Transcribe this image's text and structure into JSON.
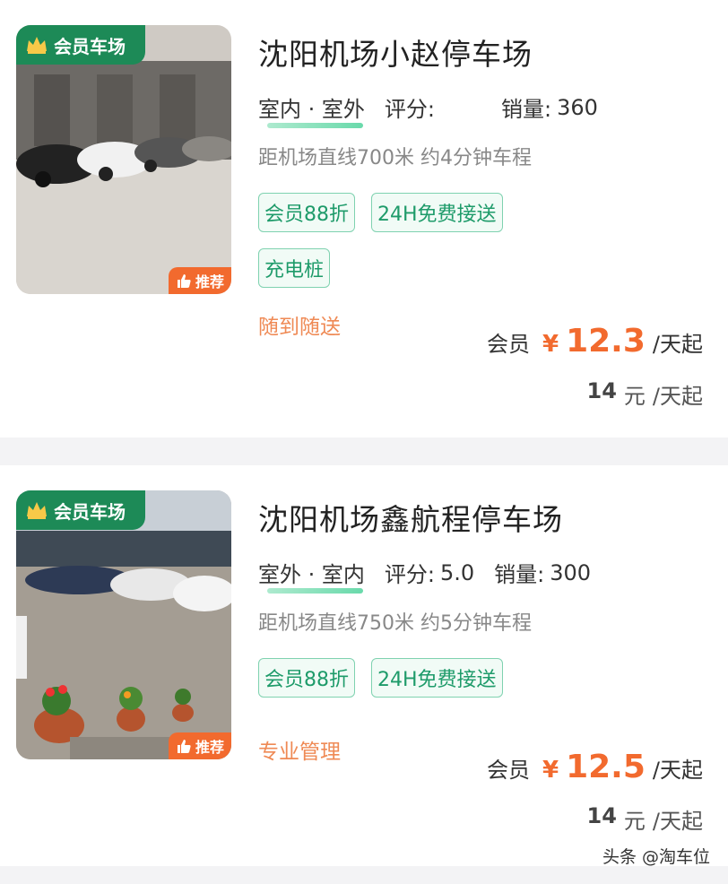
{
  "listings": [
    {
      "badge": "会员车场",
      "recommend": "推荐",
      "title": "沈阳机场小赵停车场",
      "type": "室内 · 室外",
      "rating_label": "评分:",
      "rating": "",
      "sales_label": "销量:",
      "sales": "360",
      "distance": "距机场直线700米 约4分钟车程",
      "tags": [
        "会员88折",
        "24H免费接送",
        "充电桩"
      ],
      "slogan": "随到随送",
      "member_label": "会员",
      "yen": "¥",
      "member_price": "12.3",
      "unit": "/天起",
      "orig_price": "14",
      "orig_unit": "元",
      "orig_suffix": "/天起"
    },
    {
      "badge": "会员车场",
      "recommend": "推荐",
      "title": "沈阳机场鑫航程停车场",
      "type": "室外 · 室内",
      "rating_label": "评分:",
      "rating": "5.0",
      "sales_label": "销量:",
      "sales": "300",
      "distance": "距机场直线750米 约5分钟车程",
      "tags": [
        "会员88折",
        "24H免费接送"
      ],
      "slogan": "专业管理",
      "member_label": "会员",
      "yen": "¥",
      "member_price": "12.5",
      "unit": "/天起",
      "orig_price": "14",
      "orig_unit": "元",
      "orig_suffix": "/天起"
    }
  ],
  "watermark": "头条 @淘车位"
}
